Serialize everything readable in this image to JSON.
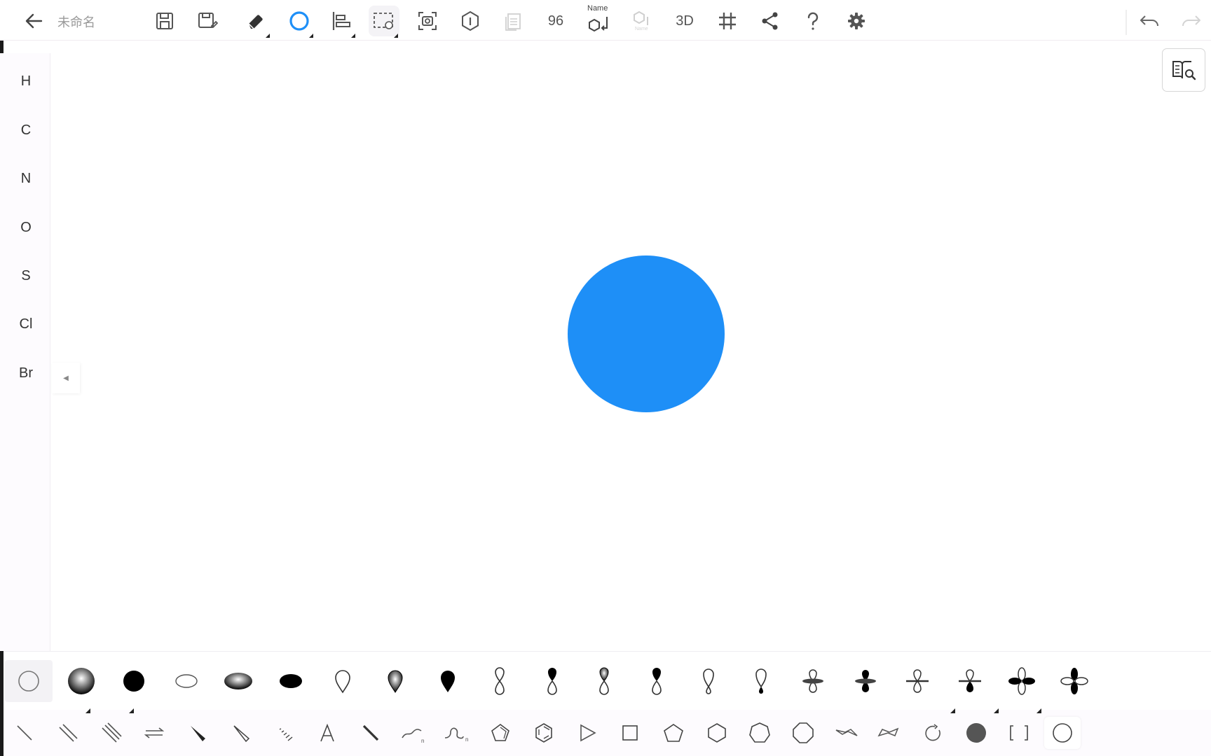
{
  "app": {
    "document_title": "未命名"
  },
  "toolbar": {
    "font_size_label": "96",
    "name_tool_label": "Name",
    "name_tool_disabled_label": "Name",
    "view_3d_label": "3D"
  },
  "element_bar": {
    "items": [
      "H",
      "C",
      "N",
      "O",
      "S",
      "Cl",
      "Br"
    ]
  },
  "canvas": {
    "shape": "circle",
    "shape_color": "#1e8ff7"
  },
  "orbital_palette": {
    "selected_index": 0,
    "items": [
      "s-orbital-outline-icon",
      "s-orbital-shaded-icon",
      "s-orbital-filled-icon",
      "flat-orbital-outline-icon",
      "flat-orbital-shaded-icon",
      "flat-orbital-filled-icon",
      "p-lobe-outline-icon",
      "p-lobe-shaded-icon",
      "p-lobe-filled-icon",
      "p-orbital-outline-icon",
      "p-orbital-half-filled-icon",
      "p-orbital-shaded-icon",
      "p-orbital-filled-icon",
      "p-orbital-outline-alt-icon",
      "p-orbital-half-alt-icon",
      "dz2-orbital-outline-icon",
      "dz2-orbital-filled-icon",
      "dz2-orbital-cross-icon",
      "dz2-orbital-cross-alt-icon",
      "d-orbital-clover-outline-icon",
      "d-orbital-clover-filled-icon"
    ]
  },
  "tool_palette": {
    "selected_index": 24,
    "items": [
      "single-bond-icon",
      "double-bond-icon",
      "triple-bond-icon",
      "reaction-arrows-icon",
      "wedge-bond-icon",
      "hollow-wedge-bond-icon",
      "hashed-bond-icon",
      "text-tool-icon",
      "bold-bond-icon",
      "wavy-chain-icon",
      "curve-chain-icon",
      "pentagon-ring-icon",
      "benzene-ring-icon",
      "triangle-shape-icon",
      "square-shape-icon",
      "pentagon-shape-icon",
      "hexagon-shape-icon",
      "heptagon-shape-icon",
      "octagon-shape-icon",
      "chair-conformation-icon",
      "boat-conformation-icon",
      "rotate-arrow-icon",
      "filled-circle-icon",
      "bracket-icon",
      "circle-shape-icon"
    ]
  }
}
